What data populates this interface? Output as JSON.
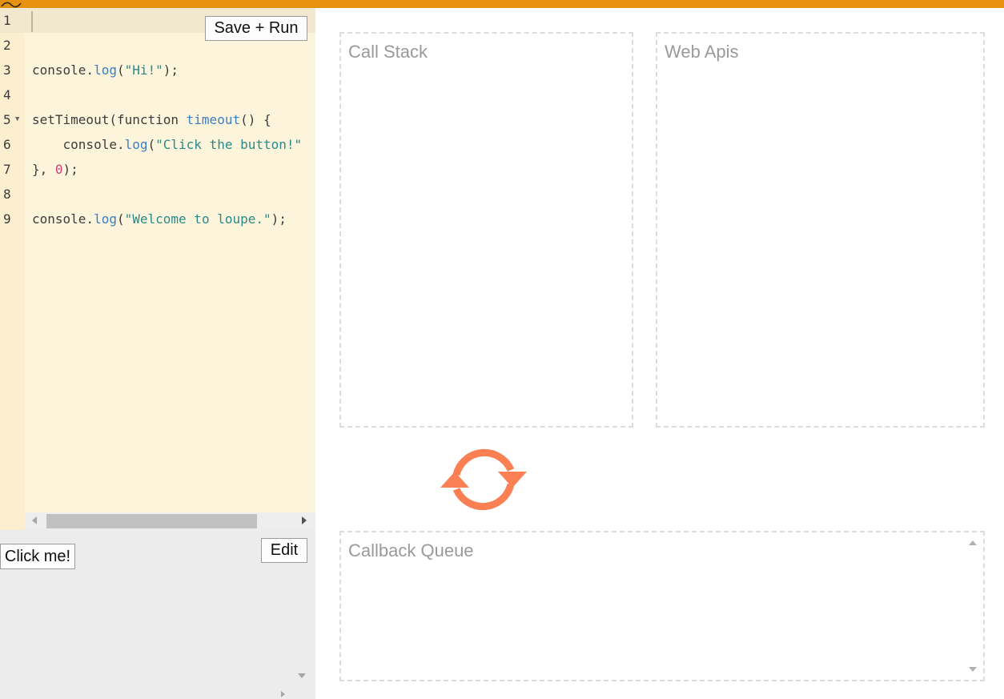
{
  "editor": {
    "save_run_label": "Save + Run",
    "lines": [
      {
        "num": "1",
        "fold": "",
        "parts": []
      },
      {
        "num": "2",
        "fold": "",
        "parts": []
      },
      {
        "num": "3",
        "fold": "",
        "parts": [
          {
            "t": "console.",
            "c": ""
          },
          {
            "t": "log",
            "c": "fn"
          },
          {
            "t": "(",
            "c": ""
          },
          {
            "t": "\"Hi!\"",
            "c": "str"
          },
          {
            "t": ");",
            "c": ""
          }
        ]
      },
      {
        "num": "4",
        "fold": "",
        "parts": []
      },
      {
        "num": "5",
        "fold": "▼",
        "parts": [
          {
            "t": "setTimeout(function ",
            "c": ""
          },
          {
            "t": "timeout",
            "c": "fn"
          },
          {
            "t": "() {",
            "c": ""
          }
        ]
      },
      {
        "num": "6",
        "fold": "",
        "parts": [
          {
            "t": "    console.",
            "c": ""
          },
          {
            "t": "log",
            "c": "fn"
          },
          {
            "t": "(",
            "c": ""
          },
          {
            "t": "\"Click the button!\"",
            "c": "str"
          }
        ]
      },
      {
        "num": "7",
        "fold": "",
        "parts": [
          {
            "t": "}, ",
            "c": ""
          },
          {
            "t": "0",
            "c": "num"
          },
          {
            "t": ");",
            "c": ""
          }
        ]
      },
      {
        "num": "8",
        "fold": "",
        "parts": []
      },
      {
        "num": "9",
        "fold": "",
        "parts": [
          {
            "t": "console.",
            "c": ""
          },
          {
            "t": "log",
            "c": "fn"
          },
          {
            "t": "(",
            "c": ""
          },
          {
            "t": "\"Welcome to loupe.\"",
            "c": "str"
          },
          {
            "t": ");",
            "c": ""
          }
        ]
      }
    ]
  },
  "output": {
    "click_label": "Click me!",
    "edit_label": "Edit"
  },
  "panels": {
    "call_stack_title": "Call Stack",
    "web_apis_title": "Web Apis",
    "callback_queue_title": "Callback Queue"
  },
  "colors": {
    "topbar": "#e6920e",
    "event_loop": "#fa7f52"
  },
  "icons": {
    "event_loop": "event-loop-arrows-icon"
  }
}
